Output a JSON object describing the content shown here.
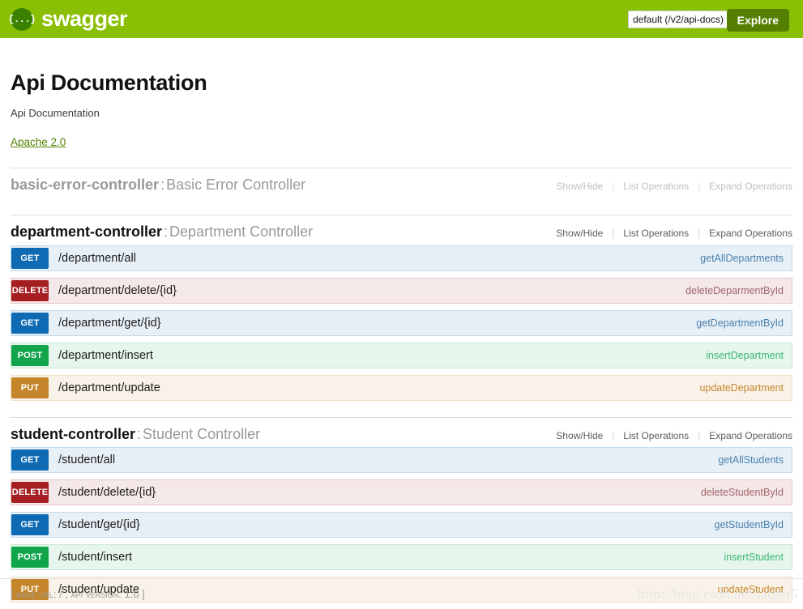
{
  "topbar": {
    "logo_text": "swagger",
    "logo_glyph": "{...}",
    "select_value": "default (/v2/api-docs)",
    "select_caret": "▼",
    "select_options": [
      "default (/v2/api-docs)"
    ],
    "explore_label": "Explore",
    "bar_color": "#89bf04",
    "explore_color": "#547f00"
  },
  "info": {
    "title": "Api Documentation",
    "description": "Api Documentation",
    "license": "Apache 2.0"
  },
  "options_labels": {
    "show_hide": "Show/Hide",
    "list_operations": "List Operations",
    "expand_operations": "Expand Operations"
  },
  "resources": [
    {
      "name": "basic-error-controller",
      "separator": ":",
      "description": "Basic Error Controller",
      "state": "muted",
      "operations": []
    },
    {
      "name": "department-controller",
      "separator": ":",
      "description": "Department Controller",
      "state": "active",
      "operations": [
        {
          "method": "GET",
          "path": "/department/all",
          "nickname": "getAllDepartments"
        },
        {
          "method": "DELETE",
          "path": "/department/delete/{id}",
          "nickname": "deleteDeparmentById"
        },
        {
          "method": "GET",
          "path": "/department/get/{id}",
          "nickname": "getDepartmentById"
        },
        {
          "method": "POST",
          "path": "/department/insert",
          "nickname": "insertDepartment"
        },
        {
          "method": "PUT",
          "path": "/department/update",
          "nickname": "updateDepartment"
        }
      ]
    },
    {
      "name": "student-controller",
      "separator": ":",
      "description": "Student Controller",
      "state": "active",
      "operations": [
        {
          "method": "GET",
          "path": "/student/all",
          "nickname": "getAllStudents"
        },
        {
          "method": "DELETE",
          "path": "/student/delete/{id}",
          "nickname": "deleteStudentById"
        },
        {
          "method": "GET",
          "path": "/student/get/{id}",
          "nickname": "getStudentById"
        },
        {
          "method": "POST",
          "path": "/student/insert",
          "nickname": "insertStudent"
        },
        {
          "method": "PUT",
          "path": "/student/update",
          "nickname": "updateStudent"
        }
      ]
    }
  ],
  "footer": {
    "open_bracket": "[",
    "base_url_label": "BASE URL",
    "base_url_value": "/",
    "comma": ",",
    "api_version_label": "API VERSION",
    "api_version_value": "1.0",
    "close_bracket": "]"
  },
  "watermark": "http://blog.csdn.net/larger5",
  "method_colors": {
    "GET": "#0f6ab4",
    "POST": "#10a54a",
    "PUT": "#c5862b",
    "DELETE": "#a41e22"
  }
}
